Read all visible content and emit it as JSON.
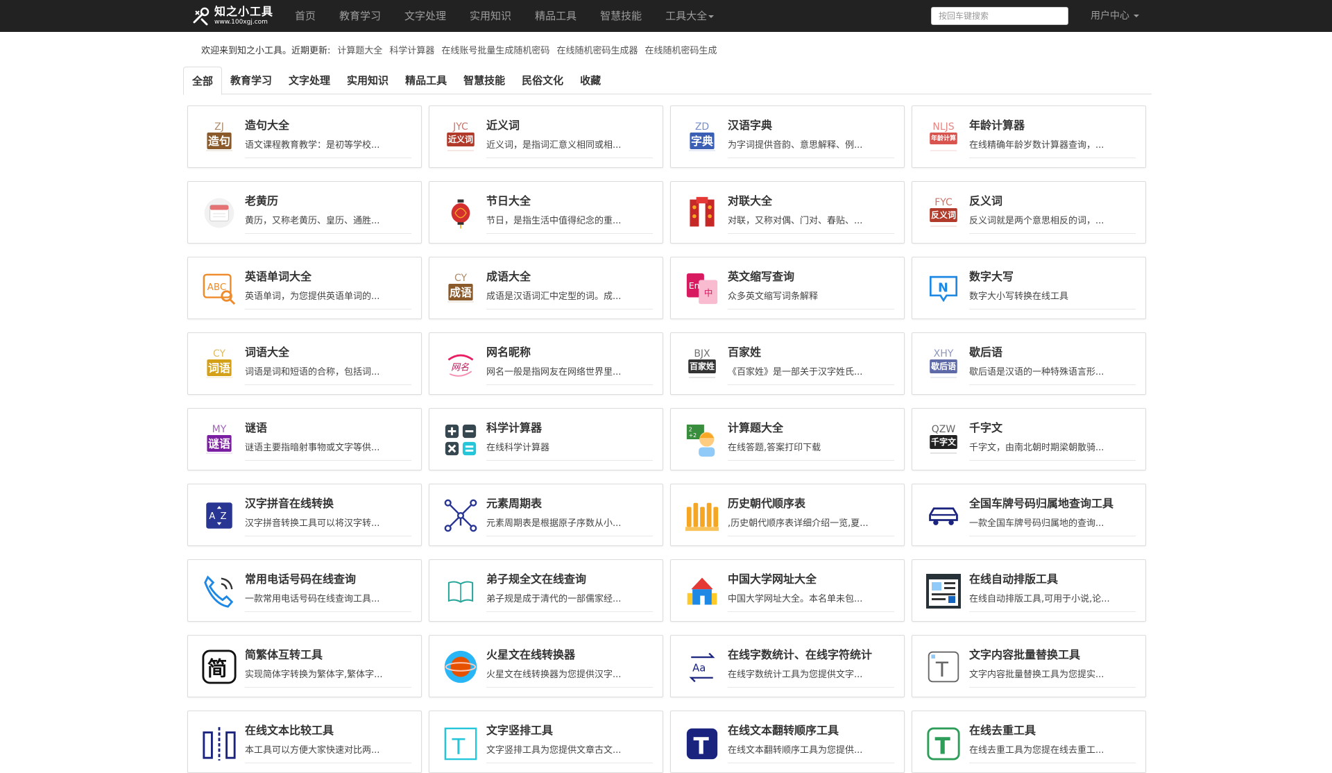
{
  "brand": {
    "name": "知之小工具",
    "url": "www.100xgj.com"
  },
  "nav": [
    {
      "label": "首页"
    },
    {
      "label": "教育学习"
    },
    {
      "label": "文字处理"
    },
    {
      "label": "实用知识"
    },
    {
      "label": "精品工具"
    },
    {
      "label": "智慧技能"
    },
    {
      "label": "工具大全",
      "dropdown": true
    }
  ],
  "search": {
    "placeholder": "按回车键搜索",
    "value": ""
  },
  "user_menu": {
    "label": "用户中心"
  },
  "notice": {
    "prefix": "欢迎来到知之小工具。近期更新:",
    "links": [
      "计算题大全",
      "科学计算器",
      "在线账号批量生成随机密码",
      "在线随机密码生成器",
      "在线随机密码生成"
    ]
  },
  "tabs": [
    {
      "label": "全部",
      "active": true
    },
    {
      "label": "教育学习"
    },
    {
      "label": "文字处理"
    },
    {
      "label": "实用知识"
    },
    {
      "label": "精品工具"
    },
    {
      "label": "智慧技能"
    },
    {
      "label": "民俗文化"
    },
    {
      "label": "收藏"
    }
  ],
  "tools": [
    {
      "title": "造句大全",
      "desc": "语文课程教育教学：是初等学校...",
      "icon": "zaoju-icon",
      "icon_text": "造句",
      "icon_sub": "ZJ",
      "color": "#8a5a2b"
    },
    {
      "title": "近义词",
      "desc": "近义词，是指词汇意义相同或相...",
      "icon": "jinyici-icon",
      "icon_text": "近义词",
      "icon_sub": "JYC",
      "color": "#b23a2a"
    },
    {
      "title": "汉语字典",
      "desc": "为字词提供音韵、意思解释、例...",
      "icon": "zidian-icon",
      "icon_text": "字典",
      "icon_sub": "ZD",
      "color": "#3b5fb5"
    },
    {
      "title": "年龄计算器",
      "desc": "在线精确年龄岁数计算器查询，...",
      "icon": "age-calculator-icon",
      "icon_text": "年龄计算",
      "icon_sub": "NLJS",
      "color": "#d9534f"
    },
    {
      "title": "老黄历",
      "desc": "黄历，又称老黄历、皇历、通胜...",
      "icon": "calendar-icon",
      "icon_text": "",
      "icon_sub": "",
      "color": "#e57373"
    },
    {
      "title": "节日大全",
      "desc": "节日，是指生活中值得纪念的重...",
      "icon": "lantern-icon",
      "icon_text": "",
      "icon_sub": "",
      "color": "#d32f2f"
    },
    {
      "title": "对联大全",
      "desc": "对联，又称对偶、门对、春贴、...",
      "icon": "couplet-icon",
      "icon_text": "",
      "icon_sub": "",
      "color": "#c62828"
    },
    {
      "title": "反义词",
      "desc": "反义词就是两个意思相反的词，...",
      "icon": "fanyici-icon",
      "icon_text": "反义词",
      "icon_sub": "FYC",
      "color": "#b23a2a"
    },
    {
      "title": "英语单词大全",
      "desc": "英语单词，为您提供英语单词的...",
      "icon": "abc-search-icon",
      "icon_text": "ABC",
      "icon_sub": "",
      "color": "#ef8a2a"
    },
    {
      "title": "成语大全",
      "desc": "成语是汉语词汇中定型的词。成...",
      "icon": "chengyu-icon",
      "icon_text": "成语",
      "icon_sub": "CY",
      "color": "#8a5a2b"
    },
    {
      "title": "英文缩写查询",
      "desc": "众多英文缩写词条解释",
      "icon": "en-zh-icon",
      "icon_text": "En",
      "icon_sub": "中",
      "color": "#d81b60"
    },
    {
      "title": "数字大写",
      "desc": "数字大小写转换在线工具",
      "icon": "number-n-icon",
      "icon_text": "N",
      "icon_sub": "",
      "color": "#1e88e5"
    },
    {
      "title": "词语大全",
      "desc": "词语是词和短语的合称，包括词...",
      "icon": "ciyu-icon",
      "icon_text": "词语",
      "icon_sub": "CY",
      "color": "#d4a017"
    },
    {
      "title": "网名昵称",
      "desc": "网名一般是指网友在网络世界里...",
      "icon": "wangming-icon",
      "icon_text": "网名",
      "icon_sub": "",
      "color": "#c2185b"
    },
    {
      "title": "百家姓",
      "desc": "《百家姓》是一部关于汉字姓氏...",
      "icon": "baijiaxing-icon",
      "icon_text": "百家姓",
      "icon_sub": "BJX",
      "color": "#333333"
    },
    {
      "title": "歇后语",
      "desc": "歇后语是汉语的一种特殊语言形...",
      "icon": "xiehouyu-icon",
      "icon_text": "歇后语",
      "icon_sub": "XHY",
      "color": "#5e6aa8"
    },
    {
      "title": "谜语",
      "desc": "谜语主要指暗射事物或文字等供...",
      "icon": "miyu-icon",
      "icon_text": "谜语",
      "icon_sub": "MY",
      "color": "#7b1fa2"
    },
    {
      "title": "科学计算器",
      "desc": "在线科学计算器",
      "icon": "calculator-icon",
      "icon_text": "",
      "icon_sub": "",
      "color": "#37474f"
    },
    {
      "title": "计算题大全",
      "desc": "在线答题,答案打印下载",
      "icon": "math-kid-icon",
      "icon_text": "",
      "icon_sub": "",
      "color": "#4caf50"
    },
    {
      "title": "千字文",
      "desc": "千字文，由南北朝时期梁朝散骑...",
      "icon": "qianziwen-icon",
      "icon_text": "千字文",
      "icon_sub": "QZW",
      "color": "#222222"
    },
    {
      "title": "汉字拼音在线转换",
      "desc": "汉字拼音转换工具可以将汉字转...",
      "icon": "az-sort-icon",
      "icon_text": "AZ",
      "icon_sub": "",
      "color": "#283593"
    },
    {
      "title": "元素周期表",
      "desc": "元素周期表是根据原子序数从小...",
      "icon": "molecule-icon",
      "icon_text": "",
      "icon_sub": "",
      "color": "#283593"
    },
    {
      "title": "历史朝代顺序表",
      "desc": ",历史朝代顺序表详细介绍一览,夏...",
      "icon": "timeline-icon",
      "icon_text": "",
      "icon_sub": "",
      "color": "#f5a623"
    },
    {
      "title": "全国车牌号码归属地查询工具",
      "desc": "一款全国车牌号码归属地的查询...",
      "icon": "car-icon",
      "icon_text": "",
      "icon_sub": "",
      "color": "#1a237e"
    },
    {
      "title": "常用电话号码在线查询",
      "desc": "一款常用电话号码在线查询工具...",
      "icon": "phone-icon",
      "icon_text": "",
      "icon_sub": "",
      "color": "#1e88e5"
    },
    {
      "title": "弟子规全文在线查询",
      "desc": "弟子规是成于清代的一部儒家经...",
      "icon": "book-icon",
      "icon_text": "",
      "icon_sub": "",
      "color": "#26a69a"
    },
    {
      "title": "中国大学网址大全",
      "desc": "中国大学网址大全。本名单未包...",
      "icon": "school-icon",
      "icon_text": "",
      "icon_sub": "",
      "color": "#1e88e5"
    },
    {
      "title": "在线自动排版工具",
      "desc": "在线自动排版工具,可用于小说,论...",
      "icon": "layout-icon",
      "icon_text": "",
      "icon_sub": "",
      "color": "#1565c0"
    },
    {
      "title": "简繁体互转工具",
      "desc": "实现简体字转换为繁体字,繁体字...",
      "icon": "jian-icon",
      "icon_text": "简",
      "icon_sub": "",
      "color": "#111111"
    },
    {
      "title": "火星文在线转换器",
      "desc": "火星文在线转换器为您提供汉字...",
      "icon": "mars-icon",
      "icon_text": "",
      "icon_sub": "",
      "color": "#e65100"
    },
    {
      "title": "在线字数统计、在线字符统计",
      "desc": "在线字数统计工具为您提供文字...",
      "icon": "aa-convert-icon",
      "icon_text": "Aa",
      "icon_sub": "",
      "color": "#1a237e"
    },
    {
      "title": "文字内容批量替换工具",
      "desc": "文字内容批量替换工具为您提实...",
      "icon": "text-t-icon",
      "icon_text": "T",
      "icon_sub": "",
      "color": "#555555"
    },
    {
      "title": "在线文本比较工具",
      "desc": "本工具可以方便大家快速对比两...",
      "icon": "compare-icon",
      "icon_text": "",
      "icon_sub": "",
      "color": "#1a237e"
    },
    {
      "title": "文字竖排工具",
      "desc": "文字竖排工具为您提供文章古文...",
      "icon": "vertical-text-icon",
      "icon_text": "T",
      "icon_sub": "",
      "color": "#26c6da"
    },
    {
      "title": "在线文本翻转顺序工具",
      "desc": "在线文本翻转顺序工具为您提供...",
      "icon": "flip-t-icon",
      "icon_text": "T",
      "icon_sub": "",
      "color": "#1a237e"
    },
    {
      "title": "在线去重工具",
      "desc": "在线去重工具为您提在线去重工...",
      "icon": "dedupe-icon",
      "icon_text": "T",
      "icon_sub": "",
      "color": "#2e9d5a"
    }
  ]
}
